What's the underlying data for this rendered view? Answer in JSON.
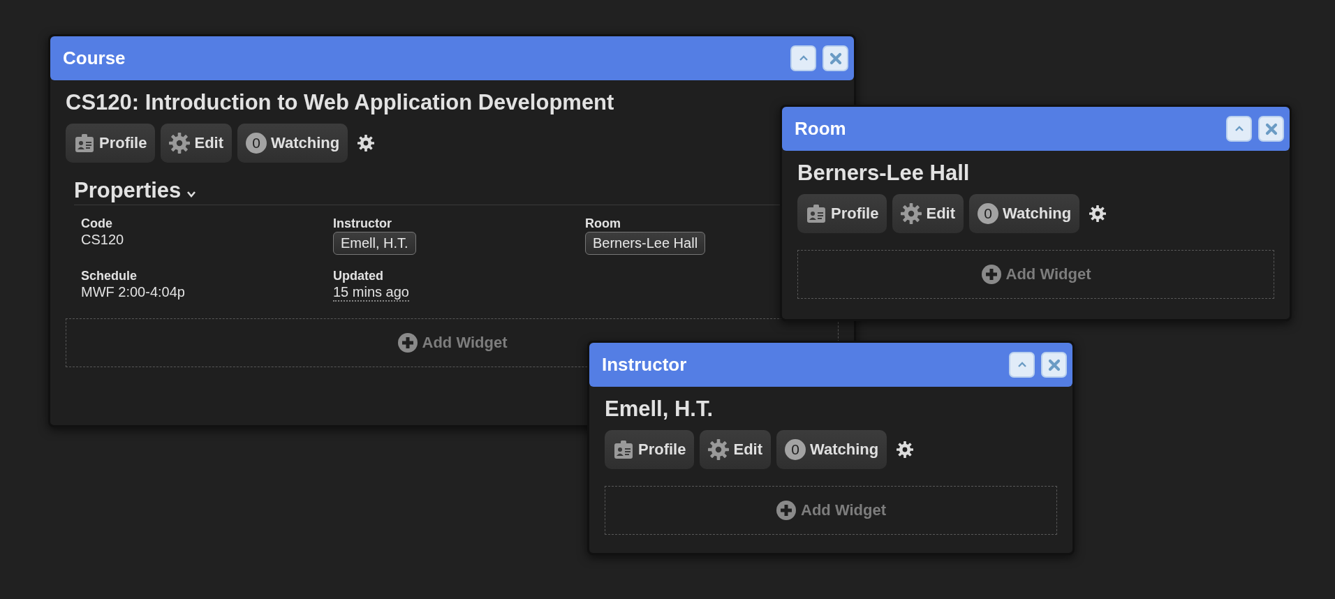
{
  "windows": [
    {
      "kind": "course",
      "title": "Course",
      "heading": "CS120: Introduction to Web Application Development",
      "buttons": [
        {
          "kind": "profile",
          "label": "Profile"
        },
        {
          "kind": "edit",
          "label": "Edit"
        },
        {
          "kind": "watching",
          "count": "0",
          "label": "Watching"
        }
      ],
      "properties": {
        "title": "Properties",
        "expanded": true,
        "fields": [
          {
            "kind": "text",
            "label": "Code",
            "value": "CS120"
          },
          {
            "kind": "chip",
            "label": "Instructor",
            "value": "Emell, H.T."
          },
          {
            "kind": "chip",
            "label": "Room",
            "value": "Berners-Lee Hall"
          },
          {
            "kind": "text",
            "label": "Schedule",
            "value": "MWF 2:00-4:04p"
          },
          {
            "kind": "time",
            "label": "Updated",
            "value": "15 mins ago"
          }
        ]
      },
      "add_widget": "Add Widget"
    },
    {
      "kind": "room",
      "title": "Room",
      "heading": "Berners-Lee Hall",
      "buttons": [
        {
          "kind": "profile",
          "label": "Profile"
        },
        {
          "kind": "edit",
          "label": "Edit"
        },
        {
          "kind": "watching",
          "count": "0",
          "label": "Watching"
        }
      ],
      "add_widget": "Add Widget"
    },
    {
      "kind": "instructor",
      "title": "Instructor",
      "heading": "Emell, H.T.",
      "buttons": [
        {
          "kind": "profile",
          "label": "Profile"
        },
        {
          "kind": "edit",
          "label": "Edit"
        },
        {
          "kind": "watching",
          "count": "0",
          "label": "Watching"
        }
      ],
      "add_widget": "Add Widget"
    }
  ]
}
